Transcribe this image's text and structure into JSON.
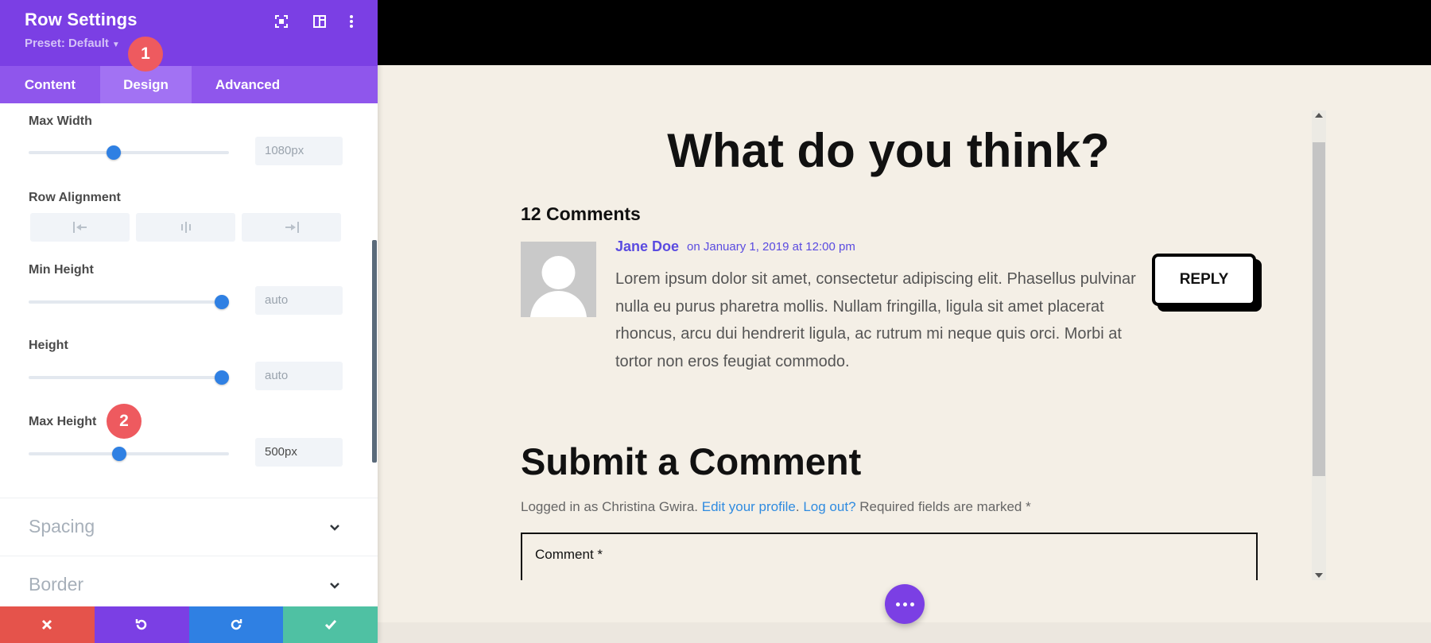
{
  "panel": {
    "title": "Row Settings",
    "preset_label": "Preset: Default",
    "tabs": [
      {
        "label": "Content",
        "active": false
      },
      {
        "label": "Design",
        "active": true
      },
      {
        "label": "Advanced",
        "active": false
      }
    ],
    "fields": {
      "max_width": {
        "label": "Max Width",
        "value": "1080px",
        "slider_fraction": 0.42
      },
      "row_alignment": {
        "label": "Row Alignment",
        "options": [
          "align-left-icon",
          "align-center-icon",
          "align-right-icon"
        ]
      },
      "min_height": {
        "label": "Min Height",
        "value": "auto",
        "slider_fraction": 1.0
      },
      "height": {
        "label": "Height",
        "value": "auto",
        "slider_fraction": 1.0
      },
      "max_height": {
        "label": "Max Height",
        "value": "500px",
        "slider_fraction": 0.45
      }
    },
    "sections": [
      {
        "label": "Spacing"
      },
      {
        "label": "Border"
      }
    ],
    "badges": [
      "1",
      "2"
    ],
    "footer_colors": {
      "cancel": "#e5534b",
      "undo": "#7b3fe4",
      "redo": "#2f80e3",
      "save": "#4fc1a3"
    }
  },
  "preview": {
    "heading": "What do you think?",
    "comments_count": "12 Comments",
    "comment": {
      "author": "Jane Doe",
      "date": "on January 1, 2019 at 12:00 pm",
      "body": "Lorem ipsum dolor sit amet, consectetur adipiscing elit. Phasellus pulvinar nulla eu purus pharetra mollis. Nullam fringilla, ligula sit amet placerat rhoncus, arcu dui hendrerit ligula, ac rutrum mi neque quis orci. Morbi at tortor non eros feugiat commodo.",
      "reply_label": "REPLY"
    },
    "submit_heading": "Submit a Comment",
    "logged_in": {
      "prefix": "Logged in as Christina Gwira.",
      "edit_profile": "Edit your profile",
      "sep": ".",
      "log_out": "Log out?",
      "required": "Required fields are marked *"
    },
    "comment_field_label": "Comment *"
  },
  "colors": {
    "accent": "#7b3fe4",
    "badge": "#ee5a5f",
    "slider": "#2f80e3",
    "link": "#2f8be0",
    "author": "#5a4be0"
  }
}
